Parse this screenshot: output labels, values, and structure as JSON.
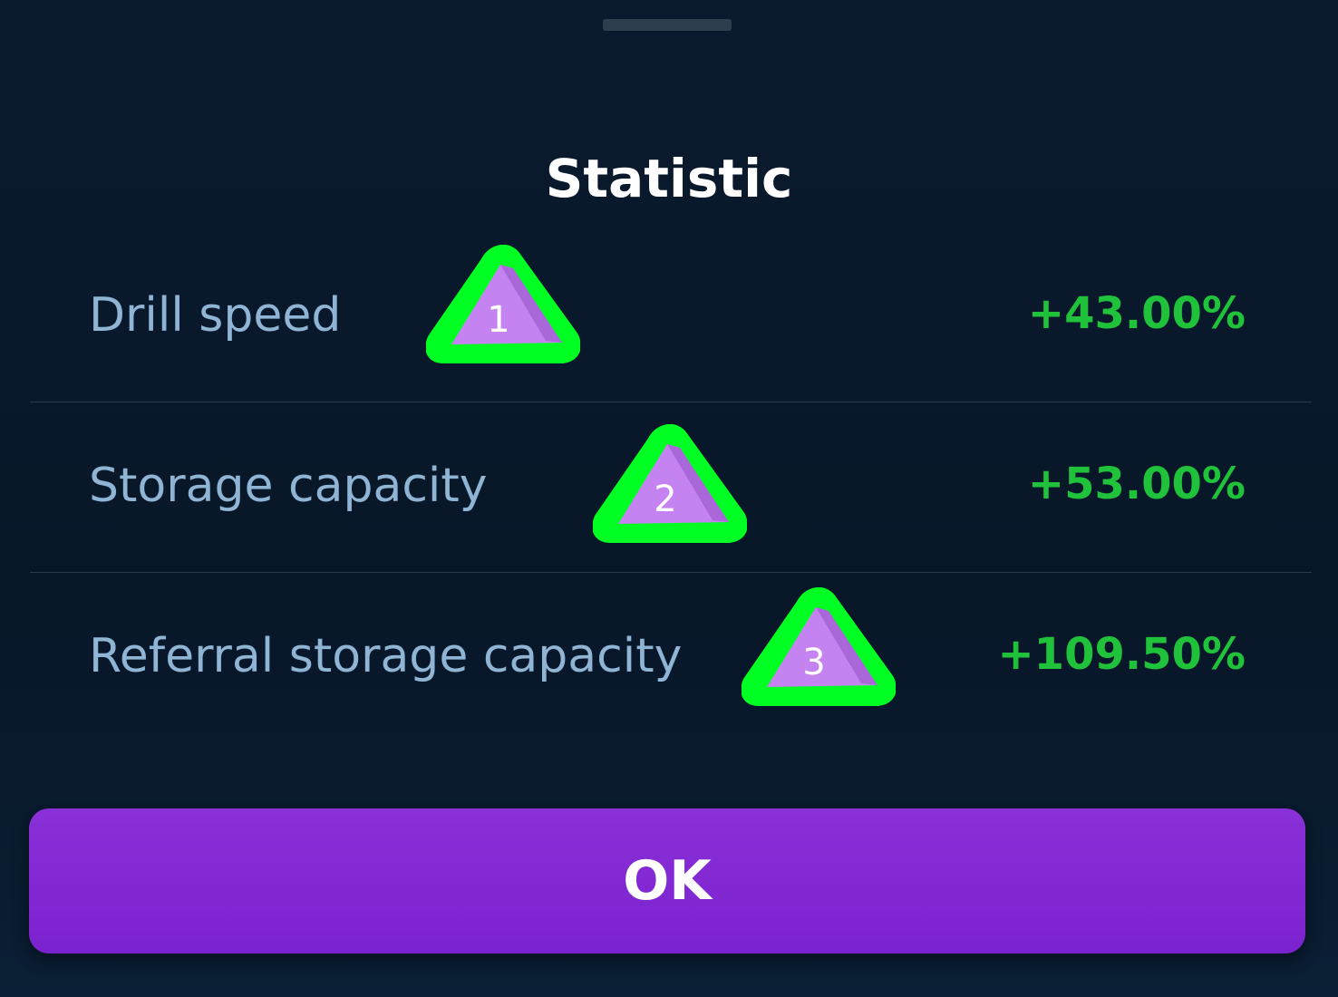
{
  "dialog": {
    "title": "Statistic",
    "ok_label": "OK"
  },
  "stats": [
    {
      "label": "Drill speed",
      "value": "+43.00%"
    },
    {
      "label": "Storage capacity",
      "value": "+53.00%"
    },
    {
      "label": "Referral storage capacity",
      "value": "+109.50%"
    }
  ],
  "markers": [
    "1",
    "2",
    "3"
  ],
  "colors": {
    "label": "#8fb4d4",
    "value": "#1fc23a",
    "button": "#7b22cf",
    "marker_fill": "#c583f2",
    "marker_outline": "#00ff22"
  }
}
